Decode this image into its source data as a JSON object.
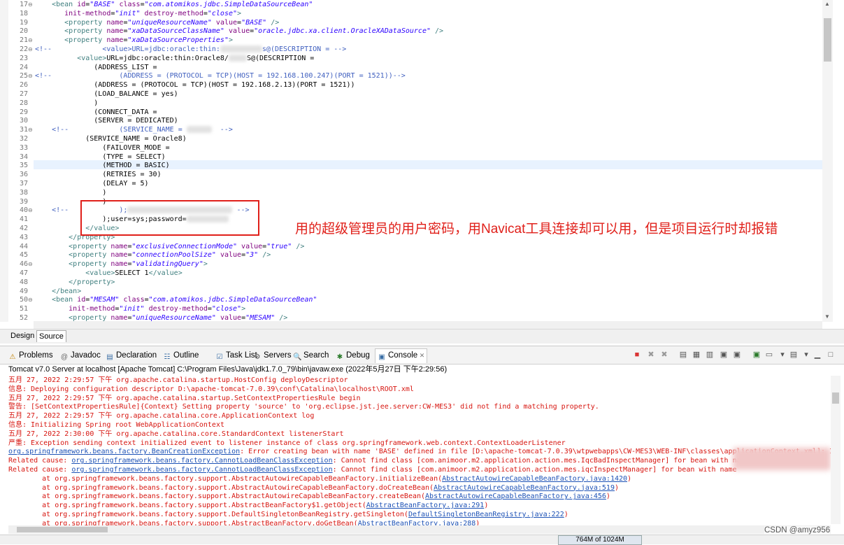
{
  "editor": {
    "lines": [
      {
        "n": "17",
        "fold": "⊖",
        "html": "<span class='tag'>&lt;bean</span> <span class='att'>id</span>=<span class='val'>\"BASE\"</span> <span class='att'>class</span>=<span class='val'>\"com.atomikos.jdbc.SimpleDataSourceBean\"</span>",
        "indent": 4
      },
      {
        "n": "18",
        "fold": "",
        "html": "<span class='att'>init-method</span>=<span class='val'>\"init\"</span> <span class='att'>destroy-method</span>=<span class='val'>\"close\"</span><span class='tag'>&gt;</span>",
        "indent": 7
      },
      {
        "n": "19",
        "fold": "",
        "html": "<span class='tag'>&lt;property</span> <span class='att'>name</span>=<span class='val'>\"uniqueResourceName\"</span> <span class='att'>value</span>=<span class='val'>\"BASE\"</span> <span class='tag'>/&gt;</span>",
        "indent": 7
      },
      {
        "n": "20",
        "fold": "",
        "html": "<span class='tag'>&lt;property</span> <span class='att'>name</span>=<span class='val'>\"xaDataSourceClassName\"</span> <span class='att'>value</span>=<span class='val'>\"oracle.jdbc.xa.client.OracleXADataSource\"</span> <span class='tag'>/&gt;</span>",
        "indent": 7
      },
      {
        "n": "21",
        "fold": "⊖",
        "html": "<span class='tag'>&lt;property</span> <span class='att'>name</span>=<span class='val'>\"xaDataSourceProperties\"</span><span class='tag'>&gt;</span>",
        "indent": 7
      },
      {
        "n": "22",
        "fold": "⊖",
        "html": "<span class='com'>&lt;!--            &lt;value&gt;URL=jdbc:oracle:thin:<span class='blur' style='width:60px;height:10px'></span>s@(DESCRIPTION = --&gt;</span>",
        "indent": 0
      },
      {
        "n": "23",
        "fold": "",
        "html": "<span class='tag'>&lt;value&gt;</span>URL=jdbc:oracle:thin:Oracle8/<span class='blur' style='width:26px;height:10px'></span>S@(DESCRIPTION =",
        "indent": 10
      },
      {
        "n": "24",
        "fold": "",
        "html": "(ADDRESS_LIST =",
        "indent": 14
      },
      {
        "n": "25",
        "fold": "⊖",
        "html": "<span class='com'>&lt;!--                (ADDRESS = (PROTOCOL = TCP)(HOST = 192.168.100.247)(PORT = 1521))--&gt;</span>",
        "indent": 0
      },
      {
        "n": "26",
        "fold": "",
        "html": "(ADDRESS = (PROTOCOL = TCP)(HOST = 192.168.2.13)(PORT = 1521))",
        "indent": 14
      },
      {
        "n": "27",
        "fold": "",
        "html": "(LOAD_BALANCE = yes)",
        "indent": 14
      },
      {
        "n": "28",
        "fold": "",
        "html": ")",
        "indent": 14
      },
      {
        "n": "29",
        "fold": "",
        "html": "(CONNECT_DATA =",
        "indent": 14
      },
      {
        "n": "30",
        "fold": "",
        "html": "(SERVER = DEDICATED)",
        "indent": 14
      },
      {
        "n": "31",
        "fold": "⊖",
        "html": "<span class='com'>&lt;!--            (SERVICE_NAME = <span class='blur' style='width:36px;height:10px'></span>  --&gt;</span>",
        "indent": 4
      },
      {
        "n": "32",
        "fold": "",
        "html": "(SERVICE_NAME = Oracle8)",
        "indent": 12
      },
      {
        "n": "33",
        "fold": "",
        "html": "(FAILOVER_MODE =",
        "indent": 16
      },
      {
        "n": "34",
        "fold": "",
        "html": "(TYPE = SELECT)",
        "indent": 16
      },
      {
        "n": "35",
        "fold": "",
        "html": "(METHOD = BASIC)",
        "indent": 16
      },
      {
        "n": "36",
        "fold": "",
        "html": "(RETRIES = 30)",
        "indent": 16
      },
      {
        "n": "37",
        "fold": "",
        "html": "(DELAY = 5)",
        "indent": 16
      },
      {
        "n": "38",
        "fold": "",
        "html": ")",
        "indent": 16
      },
      {
        "n": "39",
        "fold": "",
        "html": ")",
        "indent": 16
      },
      {
        "n": "40",
        "fold": "⊖",
        "html": "<span class='com'>&lt;!--            );<span class='blur' style='width:150px;height:10px'></span> --&gt;</span>",
        "indent": 4
      },
      {
        "n": "41",
        "fold": "",
        "html": ");user=sys;password=<span class='blur' style='width:60px;height:10px'></span>",
        "indent": 16
      },
      {
        "n": "42",
        "fold": "",
        "html": "<span class='tag'>&lt;/value&gt;</span>",
        "indent": 12
      },
      {
        "n": "43",
        "fold": "",
        "html": "<span class='tag'>&lt;/property&gt;</span>",
        "indent": 8
      },
      {
        "n": "44",
        "fold": "",
        "html": "<span class='tag'>&lt;property</span> <span class='att'>name</span>=<span class='val'>\"exclusiveConnectionMode\"</span> <span class='att'>value</span>=<span class='val'>\"true\"</span> <span class='tag'>/&gt;</span>",
        "indent": 8
      },
      {
        "n": "45",
        "fold": "",
        "html": "<span class='tag'>&lt;property</span> <span class='att'>name</span>=<span class='val'>\"connectionPoolSize\"</span> <span class='att'>value</span>=<span class='val'>\"3\"</span> <span class='tag'>/&gt;</span>",
        "indent": 8
      },
      {
        "n": "46",
        "fold": "⊖",
        "html": "<span class='tag'>&lt;property</span> <span class='att'>name</span>=<span class='val'>\"validatingQuery\"</span><span class='tag'>&gt;</span>",
        "indent": 8
      },
      {
        "n": "47",
        "fold": "",
        "html": "<span class='tag'>&lt;value&gt;</span>SELECT 1<span class='tag'>&lt;/value&gt;</span>",
        "indent": 12
      },
      {
        "n": "48",
        "fold": "",
        "html": "<span class='tag'>&lt;/property&gt;</span>",
        "indent": 8
      },
      {
        "n": "49",
        "fold": "",
        "html": "<span class='tag'>&lt;/bean&gt;</span>",
        "indent": 4
      },
      {
        "n": "50",
        "fold": "⊖",
        "html": "<span class='tag'>&lt;bean</span> <span class='att'>id</span>=<span class='val'>\"MESAM\"</span> <span class='att'>class</span>=<span class='val'>\"com.atomikos.jdbc.SimpleDataSourceBean\"</span>",
        "indent": 4
      },
      {
        "n": "51",
        "fold": "",
        "html": "<span class='att'>init-method</span>=<span class='val'>\"init\"</span> <span class='att'>destroy-method</span>=<span class='val'>\"close\"</span><span class='tag'>&gt;</span>",
        "indent": 8
      },
      {
        "n": "52",
        "fold": "",
        "html": "<span class='tag'>&lt;property</span> <span class='att'>name</span>=<span class='val'>\"uniqueResourceName\"</span> <span class='att'>value</span>=<span class='val'>\"MESAM\"</span> <span class='tag'>/&gt;</span>",
        "indent": 8
      }
    ]
  },
  "annotation": "用的超级管理员的用户密码，用Navicat工具连接却可以用，但是项目运行时却报错",
  "editor_tabs": {
    "design": "Design",
    "source": "Source"
  },
  "views": {
    "tabs": [
      {
        "label": "Problems",
        "icon": "⚠",
        "color": "#c08000"
      },
      {
        "label": "Javadoc",
        "icon": "@",
        "color": "#666"
      },
      {
        "label": "Declaration",
        "icon": "▤",
        "color": "#3a6ea5"
      },
      {
        "label": "Outline",
        "icon": "☷",
        "color": "#3a6ea5"
      },
      {
        "label": "Task List",
        "icon": "☑",
        "color": "#3a6ea5"
      },
      {
        "label": "Servers",
        "icon": "⚙",
        "color": "#555"
      },
      {
        "label": "Search",
        "icon": "🔍",
        "color": "#c08000"
      },
      {
        "label": "Debug",
        "icon": "✱",
        "color": "#2a7a2a"
      },
      {
        "label": "Console",
        "icon": "▣",
        "color": "#3a6ea5",
        "close": "✕"
      }
    ]
  },
  "console": {
    "title": "Tomcat v7.0 Server at localhost [Apache Tomcat] C:\\Program Files\\Java\\jdk1.7.0_79\\bin\\javaw.exe (2022年5月27日 下午2:29:56)",
    "lines": [
      {
        "html": "五月 27, 2022 2:29:57 下午 org.apache.catalina.startup.HostConfig deployDescriptor"
      },
      {
        "html": "信息: Deploying configuration descriptor D:\\apache-tomcat-7.0.39\\conf\\Catalina\\localhost\\ROOT.xml"
      },
      {
        "html": "五月 27, 2022 2:29:57 下午 org.apache.catalina.startup.SetContextPropertiesRule begin"
      },
      {
        "html": "警告: [SetContextPropertiesRule]{Context} Setting property 'source' to 'org.eclipse.jst.jee.server:CW-MES3' did not find a matching property."
      },
      {
        "html": "五月 27, 2022 2:29:57 下午 org.apache.catalina.core.ApplicationContext log"
      },
      {
        "html": "信息: Initializing Spring root WebApplicationContext"
      },
      {
        "html": "五月 27, 2022 2:30:00 下午 org.apache.catalina.core.StandardContext listenerStart"
      },
      {
        "html": "严重: Exception sending context initialized event to listener instance of class org.springframework.web.context.ContextLoaderListener"
      },
      {
        "html": "<a>org.springframework.beans.factory.BeanCreationException</a>: Error creating bean with name 'BASE' defined in file [D:\\apache-tomcat-7.0.39\\wtpwebapps\\CW-MES3\\WEB-INF\\classes\\applicationContext.xml]: Inv"
      },
      {
        "html": "Related cause: <a>org.springframework.beans.factory.CannotLoadBeanClassException</a>: Cannot find class [com.animoor.m2.application.action.mes.IqcBadInspectManager] for bean with na"
      },
      {
        "html": "Related cause: <a>org.springframework.beans.factory.CannotLoadBeanClassException</a>: Cannot find class [com.animoor.m2.application.action.mes.iqcInspectManager] for bean with name"
      },
      {
        "html": "        at org.springframework.beans.factory.support.AbstractAutowireCapableBeanFactory.initializeBean(<a>AbstractAutowireCapableBeanFactory.java:1420</a>)"
      },
      {
        "html": "        at org.springframework.beans.factory.support.AbstractAutowireCapableBeanFactory.doCreateBean(<a>AbstractAutowireCapableBeanFactory.java:519</a>)"
      },
      {
        "html": "        at org.springframework.beans.factory.support.AbstractAutowireCapableBeanFactory.createBean(<a>AbstractAutowireCapableBeanFactory.java:456</a>)"
      },
      {
        "html": "        at org.springframework.beans.factory.support.AbstractBeanFactory$1.getObject(<a>AbstractBeanFactory.java:291</a>)"
      },
      {
        "html": "        at org.springframework.beans.factory.support.DefaultSingletonBeanRegistry.getSingleton(<a>DefaultSingletonBeanRegistry.java:222</a>)"
      },
      {
        "html": "        at org.springframework.beans.factory.support.AbstractBeanFactory.doGetBean(<a>AbstractBeanFactory.java:288</a>)"
      }
    ]
  },
  "status": {
    "heap": "764M of 1024M"
  },
  "watermark": "CSDN @amyz956"
}
